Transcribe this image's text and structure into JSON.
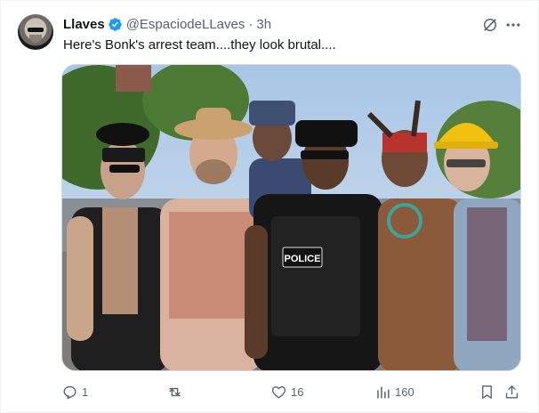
{
  "author": {
    "display_name": "Llaves",
    "handle": "@EspaciodeLLaves",
    "separator": "·",
    "time": "3h"
  },
  "tweet": {
    "text": "Here's Bonk's arrest team....they look brutal...."
  },
  "media": {
    "vest_text": "POLICE"
  },
  "actions": {
    "replies": "1",
    "retweets": "",
    "likes": "16",
    "views": "160"
  },
  "colors": {
    "text_primary": "#0f1419",
    "text_secondary": "#536471",
    "verified_blue": "#1d9bf0",
    "border": "#eff3f4"
  },
  "icons": {
    "verified": "verified-badge-icon",
    "grok": "grok-icon",
    "more": "more-dots-icon",
    "reply": "reply-icon",
    "retweet": "retweet-icon",
    "like": "heart-icon",
    "views": "views-chart-icon",
    "bookmark": "bookmark-icon",
    "share": "share-icon"
  }
}
